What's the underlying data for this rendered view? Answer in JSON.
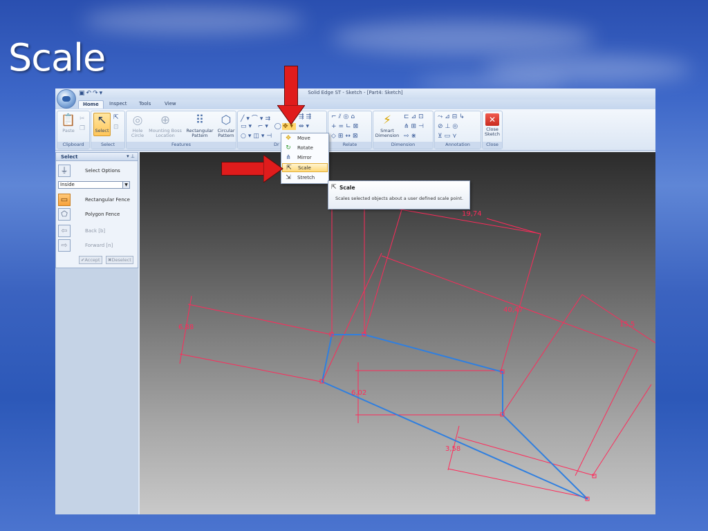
{
  "slide": {
    "title": "Scale"
  },
  "app": {
    "title": "Solid Edge ST - Sketch - [Part4: Sketch]",
    "qat_icons": [
      "save-icon",
      "undo-icon",
      "redo-icon"
    ],
    "tabs": [
      "Home",
      "Inspect",
      "Tools",
      "View"
    ],
    "active_tab": "Home"
  },
  "ribbon": {
    "groups": {
      "clipboard": "Clipboard",
      "select": "Select",
      "features": "Features",
      "draw": "Dr",
      "relate": "Relate",
      "dimension": "Dimension",
      "annotation": "Annotation",
      "close": "Close"
    },
    "buttons": {
      "paste": "Paste",
      "select": "Select",
      "hole_1": "Hole",
      "hole_2": "Circle",
      "boss_1": "Mounting Boss",
      "boss_2": "Location",
      "rect_1": "Rectangular",
      "rect_2": "Pattern",
      "circ_1": "Circular",
      "circ_2": "Pattern",
      "smart_1": "Smart",
      "smart_2": "Dimension",
      "close_1": "Close",
      "close_2": "Sketch"
    }
  },
  "panel": {
    "title": "Select",
    "select_options": "Select Options",
    "mode_value": "Inside",
    "rect_fence": "Rectangular Fence",
    "poly_fence": "Polygon Fence",
    "back": "Back [b]",
    "forward": "Forward [n]",
    "accept": "Accept",
    "deselect": "Deselect"
  },
  "menu": {
    "items": [
      {
        "label": "Move",
        "icon": "move-icon"
      },
      {
        "label": "Rotate",
        "icon": "rotate-icon"
      },
      {
        "label": "Mirror",
        "icon": "mirror-icon"
      },
      {
        "label": "Scale",
        "icon": "scale-icon"
      },
      {
        "label": "Stretch",
        "icon": "stretch-icon"
      }
    ],
    "highlighted": "Scale"
  },
  "tooltip": {
    "title": "Scale",
    "description": "Scales selected objects about a user defined scale point."
  },
  "sketch": {
    "dimensions": [
      "19,74",
      "40,47",
      "6,88",
      "15,5",
      "6,02",
      "3,58"
    ],
    "colors": {
      "dimension": "#ff2a5a",
      "geometry": "#2f7fe0",
      "arrow": "#e01c1c"
    }
  }
}
